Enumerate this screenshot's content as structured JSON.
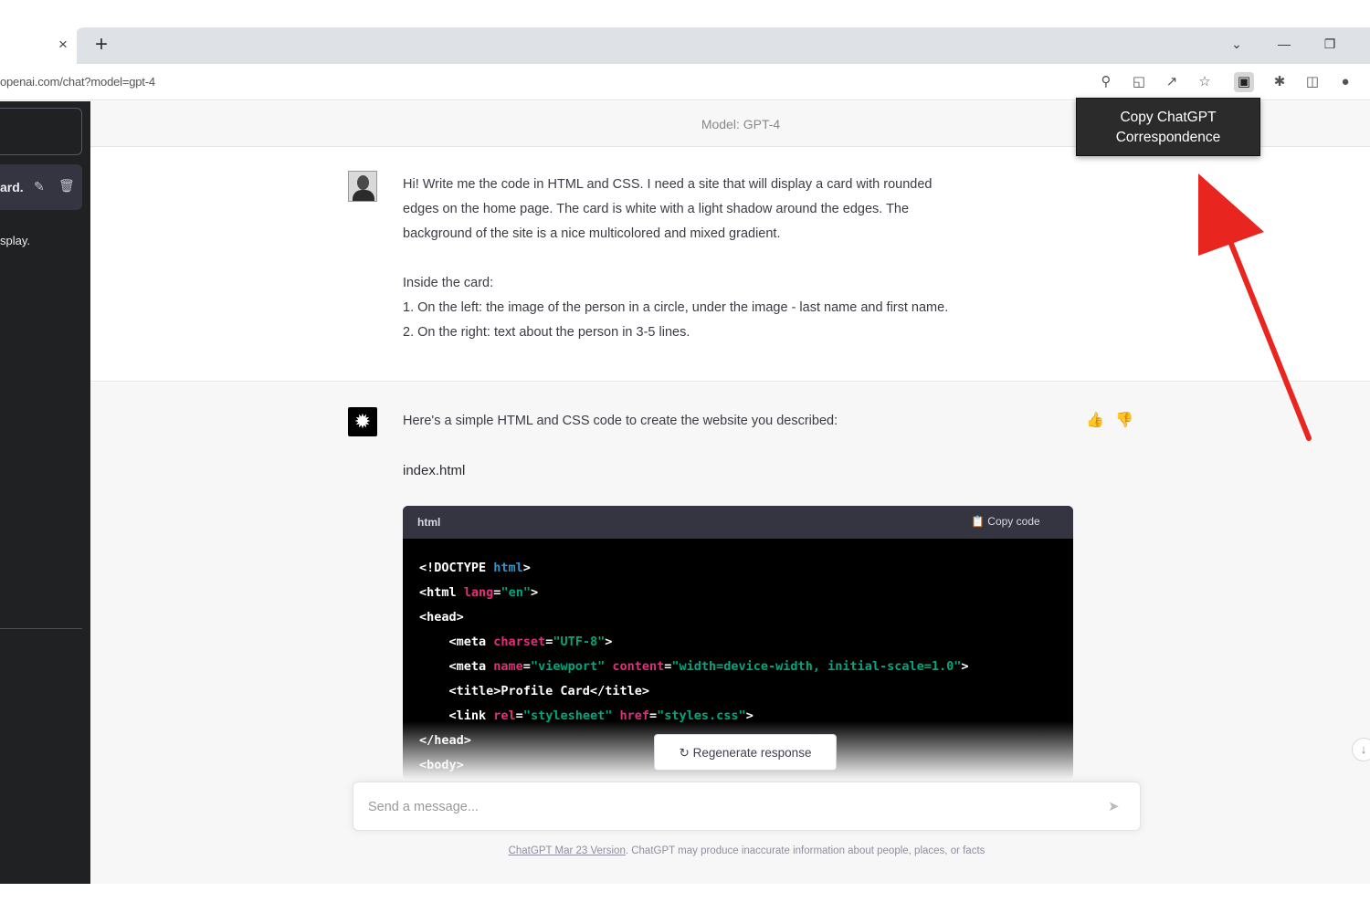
{
  "browser": {
    "tab_close": "×",
    "new_tab": "+",
    "url": "openai.com/chat?model=gpt-4",
    "window_controls": {
      "dropdown": "⌄",
      "minimize": "—",
      "restore": "❐"
    }
  },
  "sidebar": {
    "conversation_title": "ard.",
    "second_item": "splay."
  },
  "main": {
    "model_label": "Model: GPT-4",
    "user_message": [
      "Hi! Write me the code in HTML and CSS. I need a site that will display a card with rounded",
      "edges on the home page. The card is white with a light shadow around the edges. The",
      "background of the site is a nice multicolored and mixed gradient.",
      "",
      "Inside the card:",
      "1. On the left: the image of the person in a circle, under the image - last name and first name.",
      "2. On the right: text about the person in 3-5 lines."
    ],
    "assistant_intro": "Here's a simple HTML and CSS code to create the website you described:",
    "filename": "index.html",
    "code": {
      "language": "html",
      "copy_label": "Copy code",
      "lines": [
        [
          {
            "t": "<!DOCTYPE ",
            "c": "tag"
          },
          {
            "t": "html",
            "c": "kw"
          },
          {
            "t": ">",
            "c": "tag"
          }
        ],
        [
          {
            "t": "<html ",
            "c": "tag"
          },
          {
            "t": "lang",
            "c": "attr"
          },
          {
            "t": "=",
            "c": "tag"
          },
          {
            "t": "\"en\"",
            "c": "str"
          },
          {
            "t": ">",
            "c": "tag"
          }
        ],
        [
          {
            "t": "<head>",
            "c": "tag"
          }
        ],
        [
          {
            "t": "    <meta ",
            "c": "tag"
          },
          {
            "t": "charset",
            "c": "attr"
          },
          {
            "t": "=",
            "c": "tag"
          },
          {
            "t": "\"UTF-8\"",
            "c": "str"
          },
          {
            "t": ">",
            "c": "tag"
          }
        ],
        [
          {
            "t": "    <meta ",
            "c": "tag"
          },
          {
            "t": "name",
            "c": "attr"
          },
          {
            "t": "=",
            "c": "tag"
          },
          {
            "t": "\"viewport\" ",
            "c": "str"
          },
          {
            "t": "content",
            "c": "attr"
          },
          {
            "t": "=",
            "c": "tag"
          },
          {
            "t": "\"width=device-width, initial-scale=1.0\"",
            "c": "str"
          },
          {
            "t": ">",
            "c": "tag"
          }
        ],
        [
          {
            "t": "    <title>Profile Card</title>",
            "c": "tag"
          }
        ],
        [
          {
            "t": "    <link ",
            "c": "tag"
          },
          {
            "t": "rel",
            "c": "attr"
          },
          {
            "t": "=",
            "c": "tag"
          },
          {
            "t": "\"stylesheet\" ",
            "c": "str"
          },
          {
            "t": "href",
            "c": "attr"
          },
          {
            "t": "=",
            "c": "tag"
          },
          {
            "t": "\"styles.css\"",
            "c": "str"
          },
          {
            "t": ">",
            "c": "tag"
          }
        ],
        [
          {
            "t": "</head>",
            "c": "tag"
          }
        ],
        [
          {
            "t": "<body>",
            "c": "tag"
          }
        ]
      ]
    },
    "regenerate_label": "Regenerate response",
    "input_placeholder": "Send a message...",
    "footer_link": "ChatGPT Mar 23 Version",
    "footer_text": ". ChatGPT may produce inaccurate information about people, places, or facts"
  },
  "tooltip": {
    "line1": "Copy ChatGPT",
    "line2": "Correspondence"
  },
  "colors": {
    "annotation_arrow": "#e8261f",
    "sidebar_bg": "#202123"
  }
}
